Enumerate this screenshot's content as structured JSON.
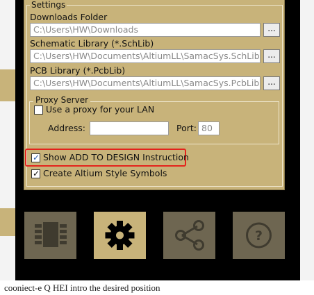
{
  "settings": {
    "group_title": "Settings",
    "downloads": {
      "label": "Downloads Folder",
      "value": "C:\\Users\\HW\\Downloads",
      "browse": "..."
    },
    "schlib": {
      "label": "Schematic Library (*.SchLib)",
      "value": "C:\\Users\\HW\\Documents\\AltiumLL\\SamacSys.SchLib",
      "browse": "..."
    },
    "pcblib": {
      "label": "PCB Library (*.PcbLib)",
      "value": "C:\\Users\\HW\\Documents\\AltiumLL\\SamacSys.PcbLib",
      "browse": "..."
    },
    "proxy": {
      "title": "Proxy Server",
      "use_proxy_label": "Use a proxy for your LAN",
      "use_proxy_checked": false,
      "address_label": "Address:",
      "address_value": "",
      "port_label": "Port:",
      "port_value": "80"
    },
    "show_add_to_design": {
      "label": "Show ADD TO DESIGN Instruction",
      "checked": true
    },
    "altium_symbols": {
      "label": "Create Altium Style Symbols",
      "checked": true
    }
  },
  "toolbar": [
    {
      "name": "component-icon",
      "active": false
    },
    {
      "name": "gear-icon",
      "active": true
    },
    {
      "name": "share-icon",
      "active": false
    },
    {
      "name": "help-icon",
      "active": false
    }
  ],
  "colors": {
    "panel": "#c8b37a",
    "active_button": "#c8b37a",
    "inactive_button": "#6e6651",
    "highlight": "#e4231c"
  },
  "background": {
    "bottom_text": "cooniect-e  Q  HEI intro the desired position"
  }
}
